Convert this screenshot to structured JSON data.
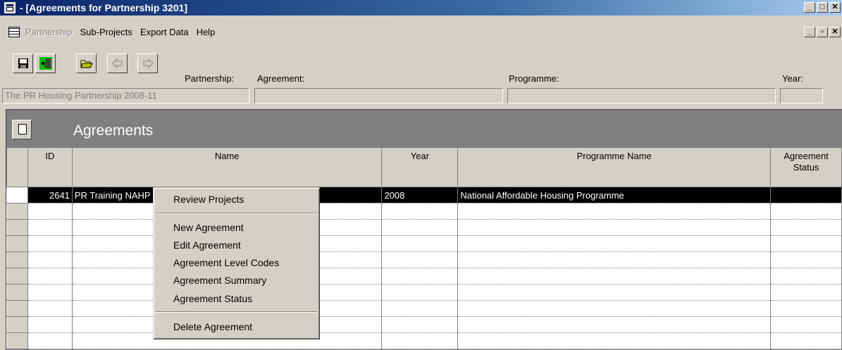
{
  "window": {
    "title": "- [Agreements for Partnership 3201]"
  },
  "menubar": {
    "items": [
      "Partnership",
      "Sub-Projects",
      "Export Data",
      "Help"
    ]
  },
  "fields": {
    "partnership_label": "Partnership:",
    "partnership_value": "The PR Housing Partnership 2008-11",
    "agreement_label": "Agreement:",
    "agreement_value": "",
    "programme_label": "Programme:",
    "programme_value": "",
    "year_label": "Year:",
    "year_value": ""
  },
  "panel": {
    "title": "Agreements"
  },
  "table": {
    "columns": [
      "ID",
      "Name",
      "Year",
      "Programme Name",
      "Agreement Status"
    ],
    "rows": [
      {
        "id": "2641",
        "name": "PR Training NAHP 2008-11",
        "year": "2008",
        "programme": "National Affordable Housing Programme",
        "status": ""
      }
    ]
  },
  "context_menu": {
    "items": [
      "Review Projects",
      "New Agreement",
      "Edit Agreement",
      "Agreement Level Codes",
      "Agreement Summary",
      "Agreement Status",
      "Delete Agreement"
    ]
  }
}
